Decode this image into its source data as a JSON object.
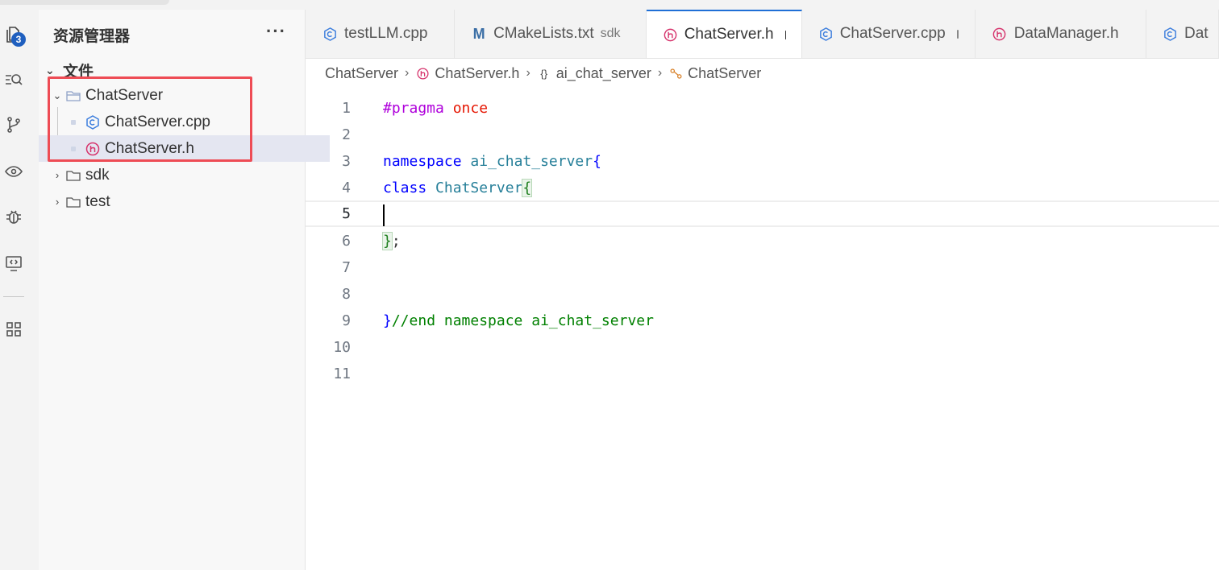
{
  "activity_bar": {
    "explorer_badge": "3",
    "items": [
      "explorer",
      "search",
      "source-control",
      "preview",
      "debug",
      "remote",
      "extensions"
    ]
  },
  "sidebar": {
    "title": "资源管理器",
    "more": "···",
    "section": "文件",
    "tree": [
      {
        "label": "ChatServer",
        "type": "folder",
        "expanded": true
      },
      {
        "label": "ChatServer.cpp",
        "type": "cpp"
      },
      {
        "label": "ChatServer.h",
        "type": "h",
        "selected": true
      },
      {
        "label": "sdk",
        "type": "folder",
        "expanded": false
      },
      {
        "label": "test",
        "type": "folder",
        "expanded": false
      }
    ]
  },
  "tabs": [
    {
      "label": "testLLM.cpp",
      "icon": "cpp-icon"
    },
    {
      "label": "CMakeLists.txt",
      "desc": "sdk",
      "icon": "cmake-icon"
    },
    {
      "label": "ChatServer.h",
      "icon": "h-icon",
      "active": true,
      "modified": true
    },
    {
      "label": "ChatServer.cpp",
      "icon": "cpp-icon",
      "modified": true
    },
    {
      "label": "DataManager.h",
      "icon": "h-icon"
    },
    {
      "label": "Dat",
      "icon": "cpp-icon"
    }
  ],
  "breadcrumb": {
    "folder": "ChatServer",
    "file": "ChatServer.h",
    "namespace": "ai_chat_server",
    "symbol": "ChatServer"
  },
  "editor": {
    "line_numbers": [
      "1",
      "2",
      "3",
      "4",
      "5",
      "6",
      "7",
      "8",
      "9",
      "10",
      "11"
    ],
    "current_line": "5",
    "code": {
      "l1_pragma": "#pragma",
      "l1_once": "once",
      "l3_namespace": "namespace",
      "l3_name": "ai_chat_server",
      "l3_brace": "{",
      "l4_class": "class",
      "l4_name": "ChatServer",
      "l4_brace": "{",
      "l6_brace": "}",
      "l6_semicolon": ";",
      "l9_brace": "}",
      "l9_comment": "//end namespace ai_chat_server"
    }
  },
  "colors": {
    "accent": "#1f6fd6",
    "highlight_box": "#ee4c55",
    "selection": "#e4e6f1"
  }
}
